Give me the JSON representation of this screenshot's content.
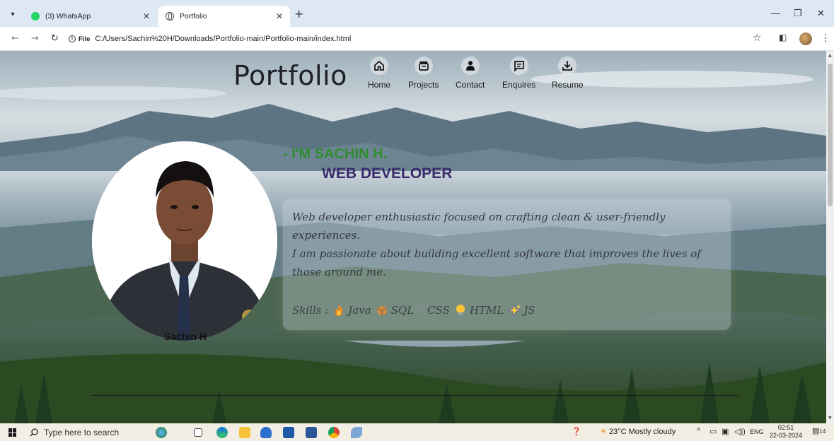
{
  "browser": {
    "tabs": [
      {
        "title": "(3) WhatsApp",
        "active": false
      },
      {
        "title": "Portfolio",
        "active": true
      }
    ],
    "file_label": "File",
    "url": "C:/Users/Sachin%20H/Downloads/Portfolio-main/Portfolio-main/index.html"
  },
  "page": {
    "brand": "Portfolio",
    "nav": [
      {
        "label": "Home",
        "icon": "home-icon"
      },
      {
        "label": "Projects",
        "icon": "projects-icon"
      },
      {
        "label": "Contact",
        "icon": "contact-icon"
      },
      {
        "label": "Enquires",
        "icon": "chat-icon"
      },
      {
        "label": "Resume",
        "icon": "download-icon"
      }
    ],
    "greeting": "- I'M SACHIN H.",
    "role": "WEB DEVELOPER",
    "about_line1": "Web developer enthusiastic focused on crafting clean & user-friendly experiences.",
    "about_line2": "I am passionate about building excellent software that improves the lives of those around me.",
    "skills_label": "Skills :",
    "skills": [
      "Java",
      "SQL",
      "CSS",
      "HTML",
      "JS"
    ],
    "photo_name": "Sachin H"
  },
  "taskbar": {
    "search_placeholder": "Type here to search",
    "weather": "23°C  Mostly cloudy",
    "language": "ENG",
    "time": "02:51",
    "date": "22-03-2024",
    "notifications": "14"
  },
  "colors": {
    "greeting": "#2f8c2f",
    "role": "#3a2a6c",
    "tabbar": "#dee7f4"
  }
}
